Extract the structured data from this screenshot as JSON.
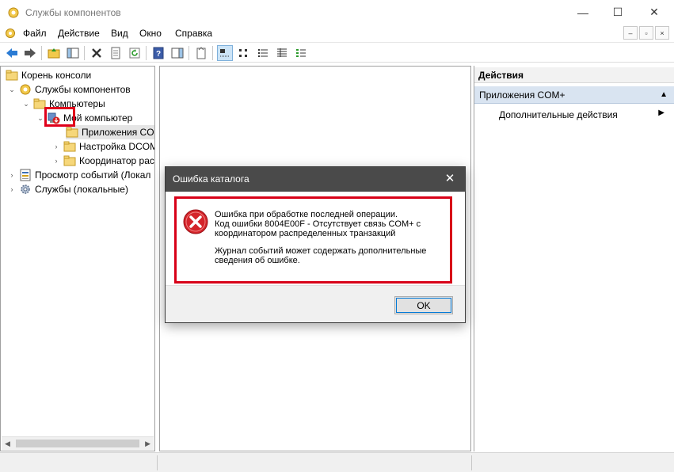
{
  "window": {
    "title": "Службы компонентов",
    "minimize": "—",
    "maximize": "☐",
    "close": "✕"
  },
  "menu": {
    "items": [
      "Файл",
      "Действие",
      "Вид",
      "Окно",
      "Справка"
    ],
    "mdi_controls": [
      "–",
      "▫",
      "×"
    ]
  },
  "tree": {
    "items": [
      {
        "label": "Корень консоли",
        "icon": "folder-icon"
      },
      {
        "label": "Службы компонентов",
        "icon": "component-services-icon"
      },
      {
        "label": "Компьютеры",
        "icon": "folder-icon"
      },
      {
        "label": "Мой компьютер",
        "icon": "computer-error-icon"
      },
      {
        "label": "Приложения CO",
        "icon": "folder-icon"
      },
      {
        "label": "Настройка DCOM",
        "icon": "folder-icon"
      },
      {
        "label": "Координатор рас",
        "icon": "folder-icon"
      },
      {
        "label": "Просмотр событий (Локал",
        "icon": "event-viewer-icon"
      },
      {
        "label": "Службы (локальные)",
        "icon": "services-gear-icon"
      }
    ]
  },
  "actions": {
    "header": "Действия",
    "section": "Приложения COM+",
    "item": "Дополнительные действия"
  },
  "dialog": {
    "title": "Ошибка каталога",
    "close": "✕",
    "lines1": [
      "Ошибка при обработке последней операции.",
      "Код ошибки 8004E00F - Отсутствует связь COM+ с",
      "координатором распределенных транзакций"
    ],
    "lines2": [
      "Журнал событий может содержать дополнительные",
      "сведения об ошибке."
    ],
    "ok": "OK"
  },
  "colors": {
    "highlight": "#e0001b",
    "dialog_header": "#4a4a4a",
    "actions_section": "#d9e4f1"
  }
}
